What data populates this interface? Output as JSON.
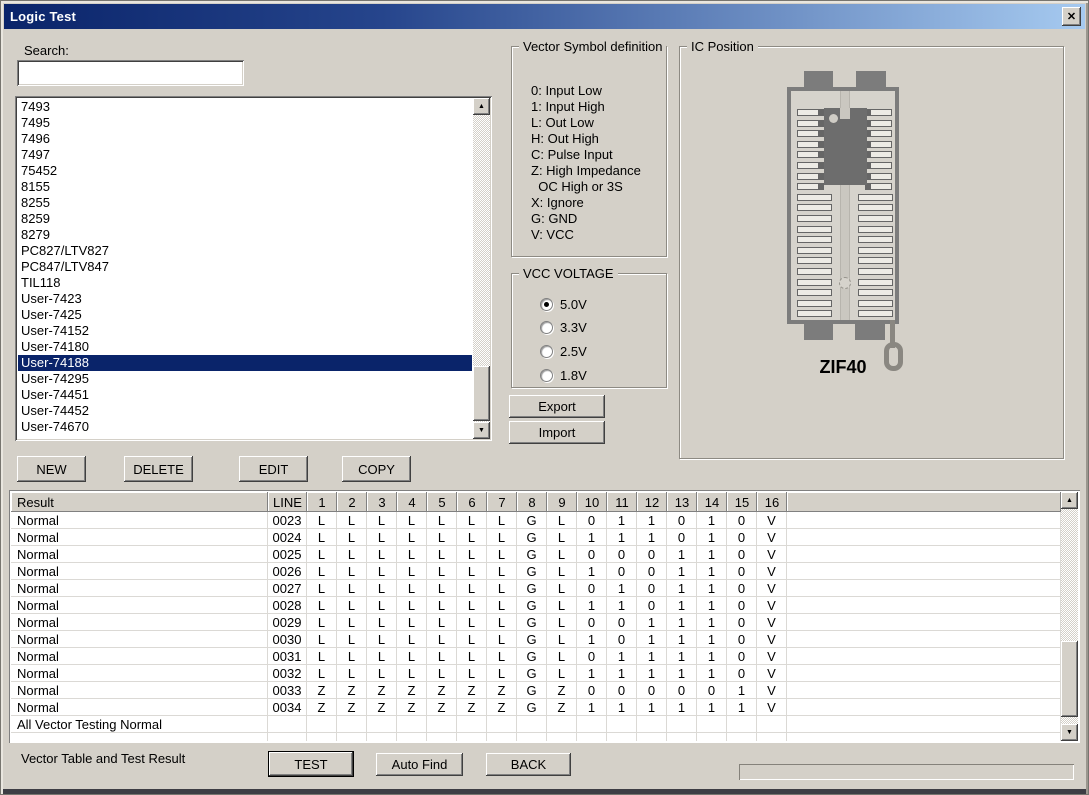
{
  "window": {
    "title": "Logic Test"
  },
  "icons": {
    "close": "✕",
    "scroll_up": "▲",
    "scroll_down": "▼"
  },
  "search": {
    "label": "Search:",
    "value": "",
    "placeholder": ""
  },
  "device_list": {
    "items": [
      "7493",
      "7495",
      "7496",
      "7497",
      "75452",
      "8155",
      "8255",
      "8259",
      "8279",
      "PC827/LTV827",
      "PC847/LTV847",
      "TIL118",
      "User-7423",
      "User-7425",
      "User-74152",
      "User-74180",
      "User-74188",
      "User-74295",
      "User-74451",
      "User-74452",
      "User-74670"
    ],
    "selected": "User-74188"
  },
  "list_buttons": {
    "new": "NEW",
    "delete": "DELETE",
    "edit": "EDIT",
    "copy": "COPY"
  },
  "vector_symbol_group": {
    "title": "Vector Symbol definition",
    "lines": [
      "0: Input Low",
      "1: Input High",
      "L: Out Low",
      "H: Out High",
      "C: Pulse Input",
      "Z: High Impedance",
      "  OC High or 3S",
      "X: Ignore",
      "G: GND",
      "V: VCC"
    ]
  },
  "vcc_voltage_group": {
    "title": "VCC VOLTAGE",
    "options": [
      {
        "label": "5.0V",
        "selected": true
      },
      {
        "label": "3.3V",
        "selected": false
      },
      {
        "label": "2.5V",
        "selected": false
      },
      {
        "label": "1.8V",
        "selected": false
      }
    ]
  },
  "io_buttons": {
    "export": "Export",
    "import": "Import"
  },
  "ic_position_group": {
    "title": "IC Position",
    "socket_label": "ZIF40",
    "pins_per_side": 20,
    "chip_rows": 8
  },
  "result_table": {
    "columns": [
      "Result",
      "LINE",
      "1",
      "2",
      "3",
      "4",
      "5",
      "6",
      "7",
      "8",
      "9",
      "10",
      "11",
      "12",
      "13",
      "14",
      "15",
      "16"
    ],
    "rows": [
      {
        "result": "Normal",
        "line": "0023",
        "values": [
          "L",
          "L",
          "L",
          "L",
          "L",
          "L",
          "L",
          "G",
          "L",
          "0",
          "1",
          "1",
          "0",
          "1",
          "0",
          "V"
        ]
      },
      {
        "result": "Normal",
        "line": "0024",
        "values": [
          "L",
          "L",
          "L",
          "L",
          "L",
          "L",
          "L",
          "G",
          "L",
          "1",
          "1",
          "1",
          "0",
          "1",
          "0",
          "V"
        ]
      },
      {
        "result": "Normal",
        "line": "0025",
        "values": [
          "L",
          "L",
          "L",
          "L",
          "L",
          "L",
          "L",
          "G",
          "L",
          "0",
          "0",
          "0",
          "1",
          "1",
          "0",
          "V"
        ]
      },
      {
        "result": "Normal",
        "line": "0026",
        "values": [
          "L",
          "L",
          "L",
          "L",
          "L",
          "L",
          "L",
          "G",
          "L",
          "1",
          "0",
          "0",
          "1",
          "1",
          "0",
          "V"
        ]
      },
      {
        "result": "Normal",
        "line": "0027",
        "values": [
          "L",
          "L",
          "L",
          "L",
          "L",
          "L",
          "L",
          "G",
          "L",
          "0",
          "1",
          "0",
          "1",
          "1",
          "0",
          "V"
        ]
      },
      {
        "result": "Normal",
        "line": "0028",
        "values": [
          "L",
          "L",
          "L",
          "L",
          "L",
          "L",
          "L",
          "G",
          "L",
          "1",
          "1",
          "0",
          "1",
          "1",
          "0",
          "V"
        ]
      },
      {
        "result": "Normal",
        "line": "0029",
        "values": [
          "L",
          "L",
          "L",
          "L",
          "L",
          "L",
          "L",
          "G",
          "L",
          "0",
          "0",
          "1",
          "1",
          "1",
          "0",
          "V"
        ]
      },
      {
        "result": "Normal",
        "line": "0030",
        "values": [
          "L",
          "L",
          "L",
          "L",
          "L",
          "L",
          "L",
          "G",
          "L",
          "1",
          "0",
          "1",
          "1",
          "1",
          "0",
          "V"
        ]
      },
      {
        "result": "Normal",
        "line": "0031",
        "values": [
          "L",
          "L",
          "L",
          "L",
          "L",
          "L",
          "L",
          "G",
          "L",
          "0",
          "1",
          "1",
          "1",
          "1",
          "0",
          "V"
        ]
      },
      {
        "result": "Normal",
        "line": "0032",
        "values": [
          "L",
          "L",
          "L",
          "L",
          "L",
          "L",
          "L",
          "G",
          "L",
          "1",
          "1",
          "1",
          "1",
          "1",
          "0",
          "V"
        ]
      },
      {
        "result": "Normal",
        "line": "0033",
        "values": [
          "Z",
          "Z",
          "Z",
          "Z",
          "Z",
          "Z",
          "Z",
          "G",
          "Z",
          "0",
          "0",
          "0",
          "0",
          "0",
          "1",
          "V"
        ]
      },
      {
        "result": "Normal",
        "line": "0034",
        "values": [
          "Z",
          "Z",
          "Z",
          "Z",
          "Z",
          "Z",
          "Z",
          "G",
          "Z",
          "1",
          "1",
          "1",
          "1",
          "1",
          "1",
          "V"
        ]
      }
    ],
    "summary_row": "All Vector Testing Normal"
  },
  "footer": {
    "caption": "Vector Table and Test Result",
    "test": "TEST",
    "auto_find": "Auto Find",
    "back": "BACK"
  },
  "colors": {
    "titlebar_start": "#0a246a",
    "titlebar_end": "#a6caf0",
    "selection": "#0a246a",
    "dialog_face": "#d4d0c8",
    "socket_gray": "#7c7c7c",
    "chip_gray": "#6d6d6d"
  }
}
